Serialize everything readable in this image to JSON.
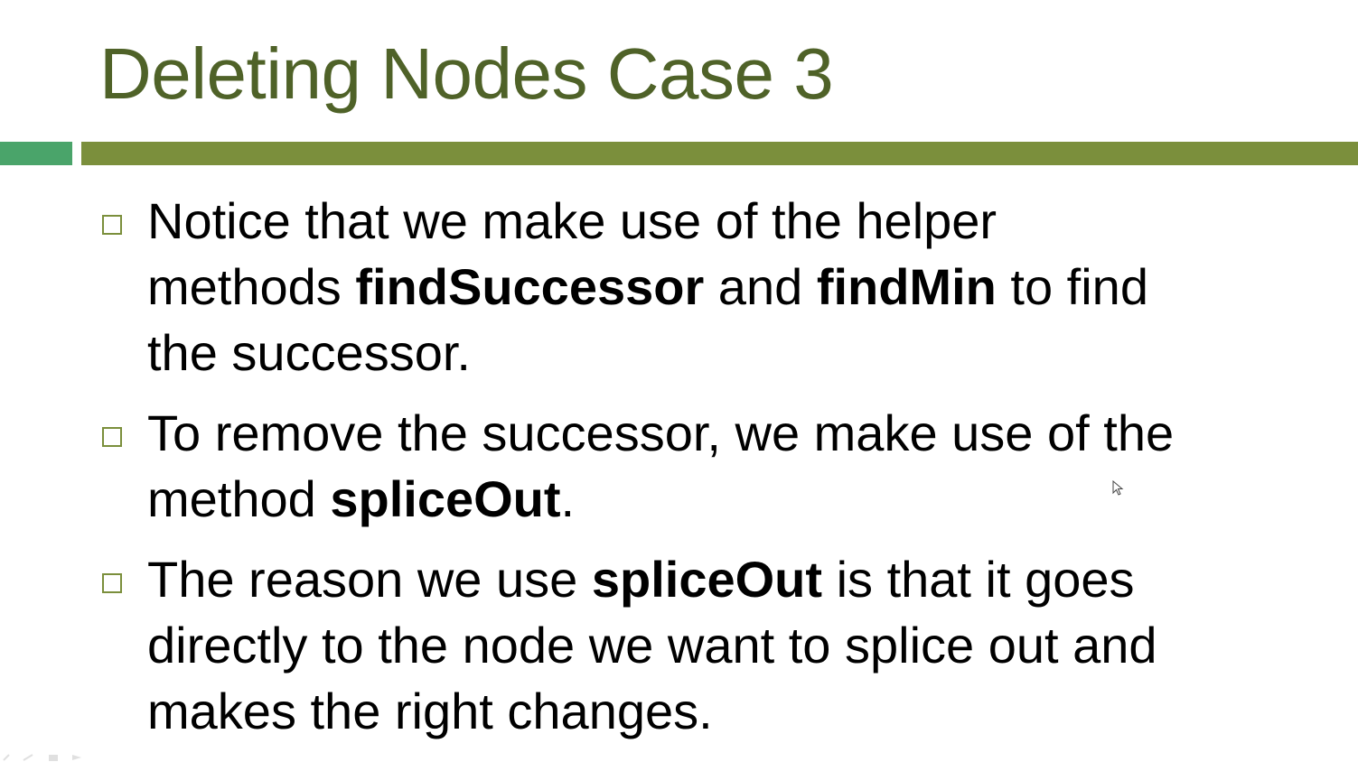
{
  "slide": {
    "title": "Deleting Nodes Case 3",
    "colors": {
      "title": "#4f6228",
      "accent_bar": "#7b8f3c",
      "accent_bar_left": "#4aa46a",
      "bullet": "#7b8f3c"
    },
    "bullets": [
      {
        "lines": [
          [
            {
              "text": " Notice that we make use of the helper",
              "bold": false
            }
          ],
          [
            {
              "text": "methods ",
              "bold": false
            },
            {
              "text": "findSuccessor",
              "bold": true
            },
            {
              "text": " and ",
              "bold": false
            },
            {
              "text": "findMin",
              "bold": true
            },
            {
              "text": " to find",
              "bold": false
            }
          ],
          [
            {
              "text": "the successor.",
              "bold": false
            }
          ]
        ]
      },
      {
        "lines": [
          [
            {
              "text": "To remove the successor, we make use of the",
              "bold": false
            }
          ],
          [
            {
              "text": "method ",
              "bold": false
            },
            {
              "text": "spliceOut",
              "bold": true
            },
            {
              "text": ".",
              "bold": false
            }
          ]
        ]
      },
      {
        "lines": [
          [
            {
              "text": "The reason we use ",
              "bold": false
            },
            {
              "text": "spliceOut",
              "bold": true
            },
            {
              "text": " is that it goes",
              "bold": false
            }
          ],
          [
            {
              "text": "directly to the node we want to splice out and",
              "bold": false
            }
          ],
          [
            {
              "text": "makes the right changes.",
              "bold": false
            }
          ]
        ]
      }
    ]
  },
  "icons": {
    "bullet": "square-bullet-icon",
    "cursor": "mouse-pointer-icon"
  }
}
